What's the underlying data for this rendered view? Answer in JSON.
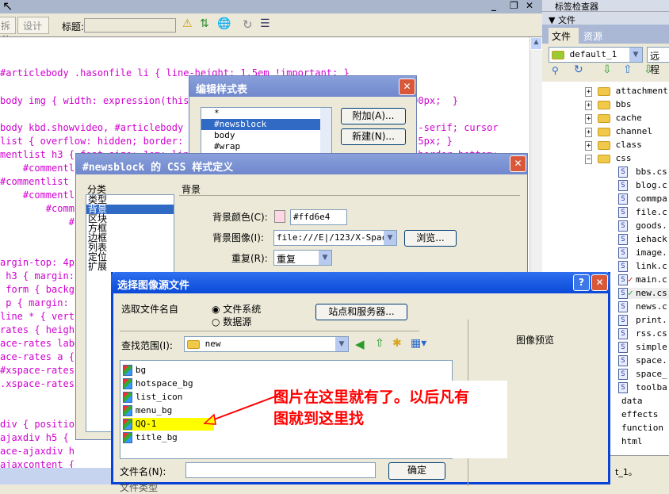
{
  "window": {
    "controls": [
      "_",
      "❐",
      "✕"
    ]
  },
  "toolbar": {
    "split": "拆分",
    "design": "设计",
    "title_label": "标题:",
    "title_value": ""
  },
  "code_lines": [
    {
      "t": "#articlebody .hasonfile li { line-height: 1.5em !important; }"
    },
    {
      "t": "body img { width: expression(this.width > 500 ? 500: true); max-width: 500px;  }"
    },
    {
      "t": "body kbd.showvideo, #articlebody k                                   sans-serif; cursor"
    },
    {
      "t": "list { overflow: hidden; border: 1                                   : 0 5px; }"
    },
    {
      "t": "mentlist h3 { font-size: 1em; line                                   FF; border-bottom:"
    },
    {
      "t": "    #commentlist img { max-width:                                  ? 500: true); }"
    },
    {
      "t": "#commentlist .messagelist li div {                                  dden; text-align: le"
    },
    {
      "t": "    #commentl"
    },
    {
      "t": "        #comm"
    },
    {
      "t": "            #"
    },
    {
      "t": "argin-top: 4px"
    },
    {
      "t": " h3 { margin: "
    },
    {
      "t": " form { backg"
    },
    {
      "t": " p { margin: "
    },
    {
      "t": "line * { vert"
    },
    {
      "t": "rates { heigh"
    },
    {
      "t": "ace-rates labe"
    },
    {
      "t": "ace-rates a { "
    },
    {
      "t": "#xspace-rates"
    },
    {
      "t": ".xspace-rates-"
    },
    {
      "t": "div { position"
    },
    {
      "t": "ajaxdiv h5 { "
    },
    {
      "t": "ace-ajaxdiv h"
    },
    {
      "t": "ajaxcontent { "
    },
    {
      "t": "ace-ajaxcontent form"
    }
  ],
  "edit_styles": {
    "title": "编辑样式表",
    "items": [
      "*",
      "#newsblock",
      "body",
      "#wrap"
    ],
    "selected": "#newsblock",
    "attach": "附加(A)...",
    "new": "新建(N)..."
  },
  "css_def": {
    "title": "#newsblock 的 CSS 样式定义",
    "category_label": "分类",
    "categories": [
      "类型",
      "背景",
      "区块",
      "方框",
      "边框",
      "列表",
      "定位",
      "扩展"
    ],
    "selected": "背景",
    "section": "背景",
    "bg_color_label": "背景颜色(C):",
    "bg_color": "#ffd6e4",
    "bg_image_label": "背景图像(I):",
    "bg_image": "file:///E|/123/X-Space",
    "browse": "浏览...",
    "repeat_label": "重复(R):",
    "repeat": "重复"
  },
  "image_dialog": {
    "title": "选择图像源文件",
    "select_from": "选取文件名自",
    "opt_fs": "文件系统",
    "opt_ds": "数据源",
    "sites": "站点和服务器...",
    "look_in_label": "查找范围(I):",
    "look_in": "new",
    "preview": "图像预览",
    "files": [
      "bg",
      "hotspace_bg",
      "list_icon",
      "menu_bg",
      "QQ-1",
      "title_bg"
    ],
    "highlighted": "QQ-1",
    "filename_label": "文件名(N):",
    "filename": "",
    "ok": "确定",
    "filetype_label": "文件类型"
  },
  "annotation": {
    "text1": "图片在这里就有了。以后凡有",
    "text2": "图就到这里找",
    "color": "#ff0000"
  },
  "right_panel": {
    "tag_inspector": "标签检查器",
    "files_header": "文件",
    "tabs": [
      "文件",
      "资源"
    ],
    "site": "default_1",
    "view": "远程",
    "folders": [
      "attachment",
      "bbs",
      "cache",
      "channel",
      "class",
      "css"
    ],
    "css_files": [
      "bbs.cs",
      "blog.c",
      "commpa",
      "file.c",
      "goods.",
      "iehack",
      "image.",
      "link.c",
      "main.c",
      "new.cs",
      "news.c",
      "print.",
      "rss.cs",
      "simple",
      "space.",
      "space_",
      "toolba"
    ],
    "checked": [
      "main.c",
      "new.cs"
    ],
    "more_folders": [
      "data",
      "effects",
      "function",
      "html"
    ],
    "status": "t_1。"
  }
}
